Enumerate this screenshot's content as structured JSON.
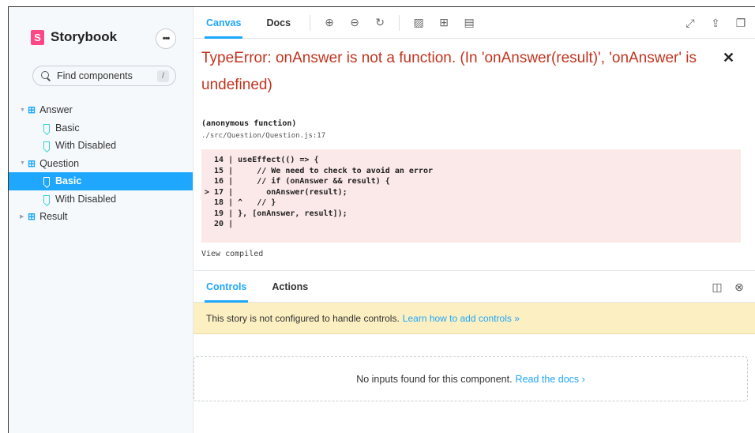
{
  "brand": {
    "logo": "S",
    "name": "Storybook"
  },
  "sidebar": {
    "menu_icon": "ellipsis-icon",
    "search": {
      "placeholder": "Find components",
      "shortcut": "/"
    },
    "tree": [
      {
        "type": "group",
        "label": "Answer",
        "expanded": true
      },
      {
        "type": "story",
        "label": "Basic",
        "selected": false
      },
      {
        "type": "story",
        "label": "With Disabled",
        "selected": false
      },
      {
        "type": "group",
        "label": "Question",
        "expanded": true
      },
      {
        "type": "story",
        "label": "Basic",
        "selected": true
      },
      {
        "type": "story",
        "label": "With Disabled",
        "selected": false
      },
      {
        "type": "group",
        "label": "Result",
        "expanded": false
      }
    ]
  },
  "toolbar": {
    "tabs": [
      {
        "label": "Canvas",
        "active": true
      },
      {
        "label": "Docs",
        "active": false
      }
    ],
    "icons": [
      "zoom-in-icon",
      "zoom-out-icon",
      "zoom-reset-icon",
      "background-icon",
      "grid-icon",
      "outline-icon"
    ],
    "right_icons": [
      "fullscreen-icon",
      "share-icon",
      "copy-link-icon"
    ]
  },
  "error": {
    "title": "TypeError: onAnswer is not a function. (In 'onAnswer(result)', 'onAnswer' is undefined)",
    "function": "(anonymous function)",
    "path": "./src/Question/Question.js:17",
    "code_lines": [
      "  14 | useEffect(() => {",
      "  15 |     // We need to check to avoid an error",
      "  16 |     // if (onAnswer && result) {",
      "> 17 |       onAnswer(result);",
      "  18 | ^   // }",
      "  19 | }, [onAnswer, result]);",
      "  20 |"
    ],
    "view_compiled": "View compiled"
  },
  "panel": {
    "tabs": [
      {
        "label": "Controls",
        "active": true
      },
      {
        "label": "Actions",
        "active": false
      }
    ],
    "notice": {
      "text": "This story is not configured to handle controls.",
      "link": "Learn how to add controls »"
    },
    "empty": {
      "text": "No inputs found for this component.",
      "link": "Read the docs ›"
    }
  }
}
